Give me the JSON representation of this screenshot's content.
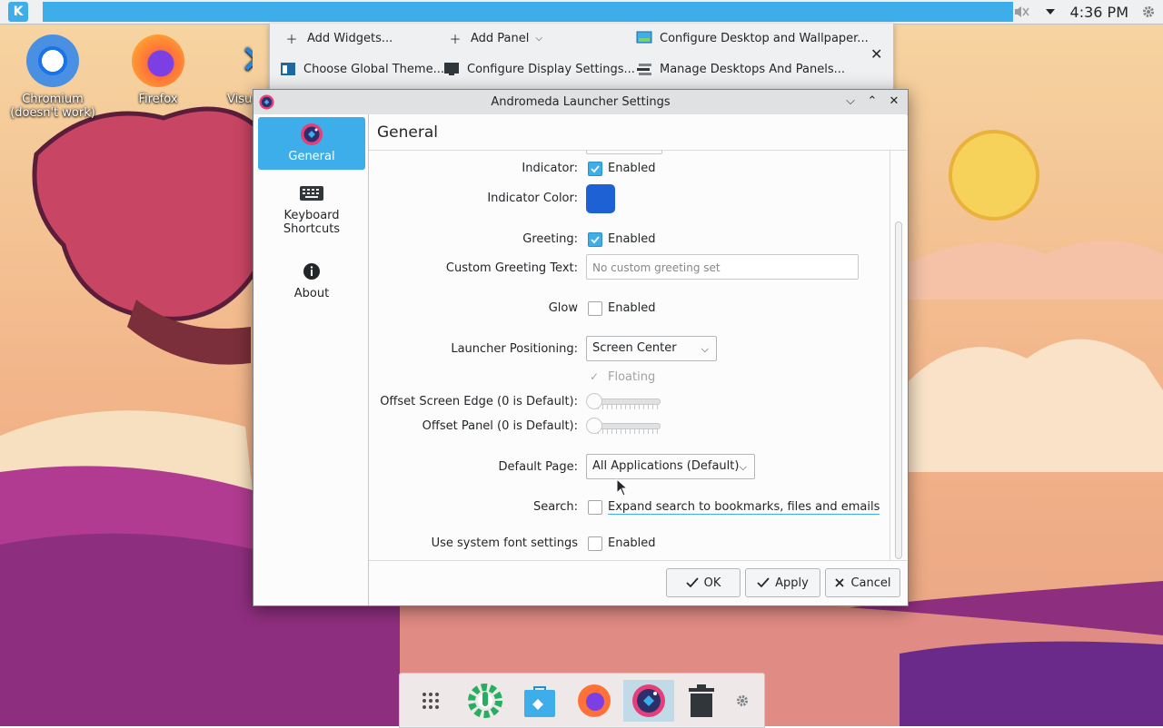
{
  "panel": {
    "clock": "4:36 PM",
    "icons": [
      "kde-menu-icon",
      "volume-muted-icon",
      "tray-expand-icon",
      "settings-icon"
    ]
  },
  "toolbox": {
    "add_widgets": "Add Widgets...",
    "add_panel": "Add Panel",
    "configure_desktop": "Configure Desktop and Wallpaper...",
    "choose_theme": "Choose Global Theme...",
    "configure_display": "Configure Display Settings...",
    "manage_desktops": "Manage Desktops And Panels..."
  },
  "desktop": {
    "icons": [
      {
        "label": "Chromium\n(doesn't work)",
        "icon": "chromium-icon"
      },
      {
        "label": "Firefox",
        "icon": "firefox-icon"
      },
      {
        "label": "Visu",
        "icon": "vscode-icon"
      }
    ]
  },
  "dialog": {
    "title": "Andromeda Launcher Settings",
    "page_title": "General",
    "sidebar": [
      {
        "label": "General",
        "icon": "andromeda-icon"
      },
      {
        "label": "Keyboard\nShortcuts",
        "icon": "keyboard-icon"
      },
      {
        "label": "About",
        "icon": "info-icon"
      }
    ],
    "settings": {
      "indicator_label": "Indicator:",
      "indicator_text": "Enabled",
      "indicator_checked": true,
      "indicator_color_label": "Indicator Color:",
      "indicator_color": "#1d61d4",
      "greeting_label": "Greeting:",
      "greeting_text": "Enabled",
      "greeting_checked": true,
      "custom_greeting_label": "Custom Greeting Text:",
      "custom_greeting_placeholder": "No custom greeting set",
      "glow_label": "Glow",
      "glow_text": "Enabled",
      "glow_checked": false,
      "positioning_label": "Launcher Positioning:",
      "positioning_value": "Screen Center",
      "floating_text": "Floating",
      "offset_edge_label": "Offset Screen Edge (0 is Default):",
      "offset_edge_value": 0,
      "offset_panel_label": "Offset Panel (0 is Default):",
      "offset_panel_value": 0,
      "default_page_label": "Default Page:",
      "default_page_value": "All Applications (Default)",
      "search_label": "Search:",
      "search_text": "Expand search to bookmarks, files and emails",
      "search_checked": false,
      "system_font_label": "Use system font settings",
      "system_font_text": "Enabled",
      "system_font_checked": false
    },
    "buttons": {
      "ok": "OK",
      "apply": "Apply",
      "cancel": "Cancel"
    }
  },
  "dock": {
    "items": [
      "app-grid-icon",
      "discover-icon",
      "store-icon",
      "firefox-icon",
      "andromeda-icon",
      "trash-icon",
      "dock-settings-icon"
    ]
  },
  "colors": {
    "accent": "#3daee9",
    "panel_bg": "#eff0f1"
  }
}
